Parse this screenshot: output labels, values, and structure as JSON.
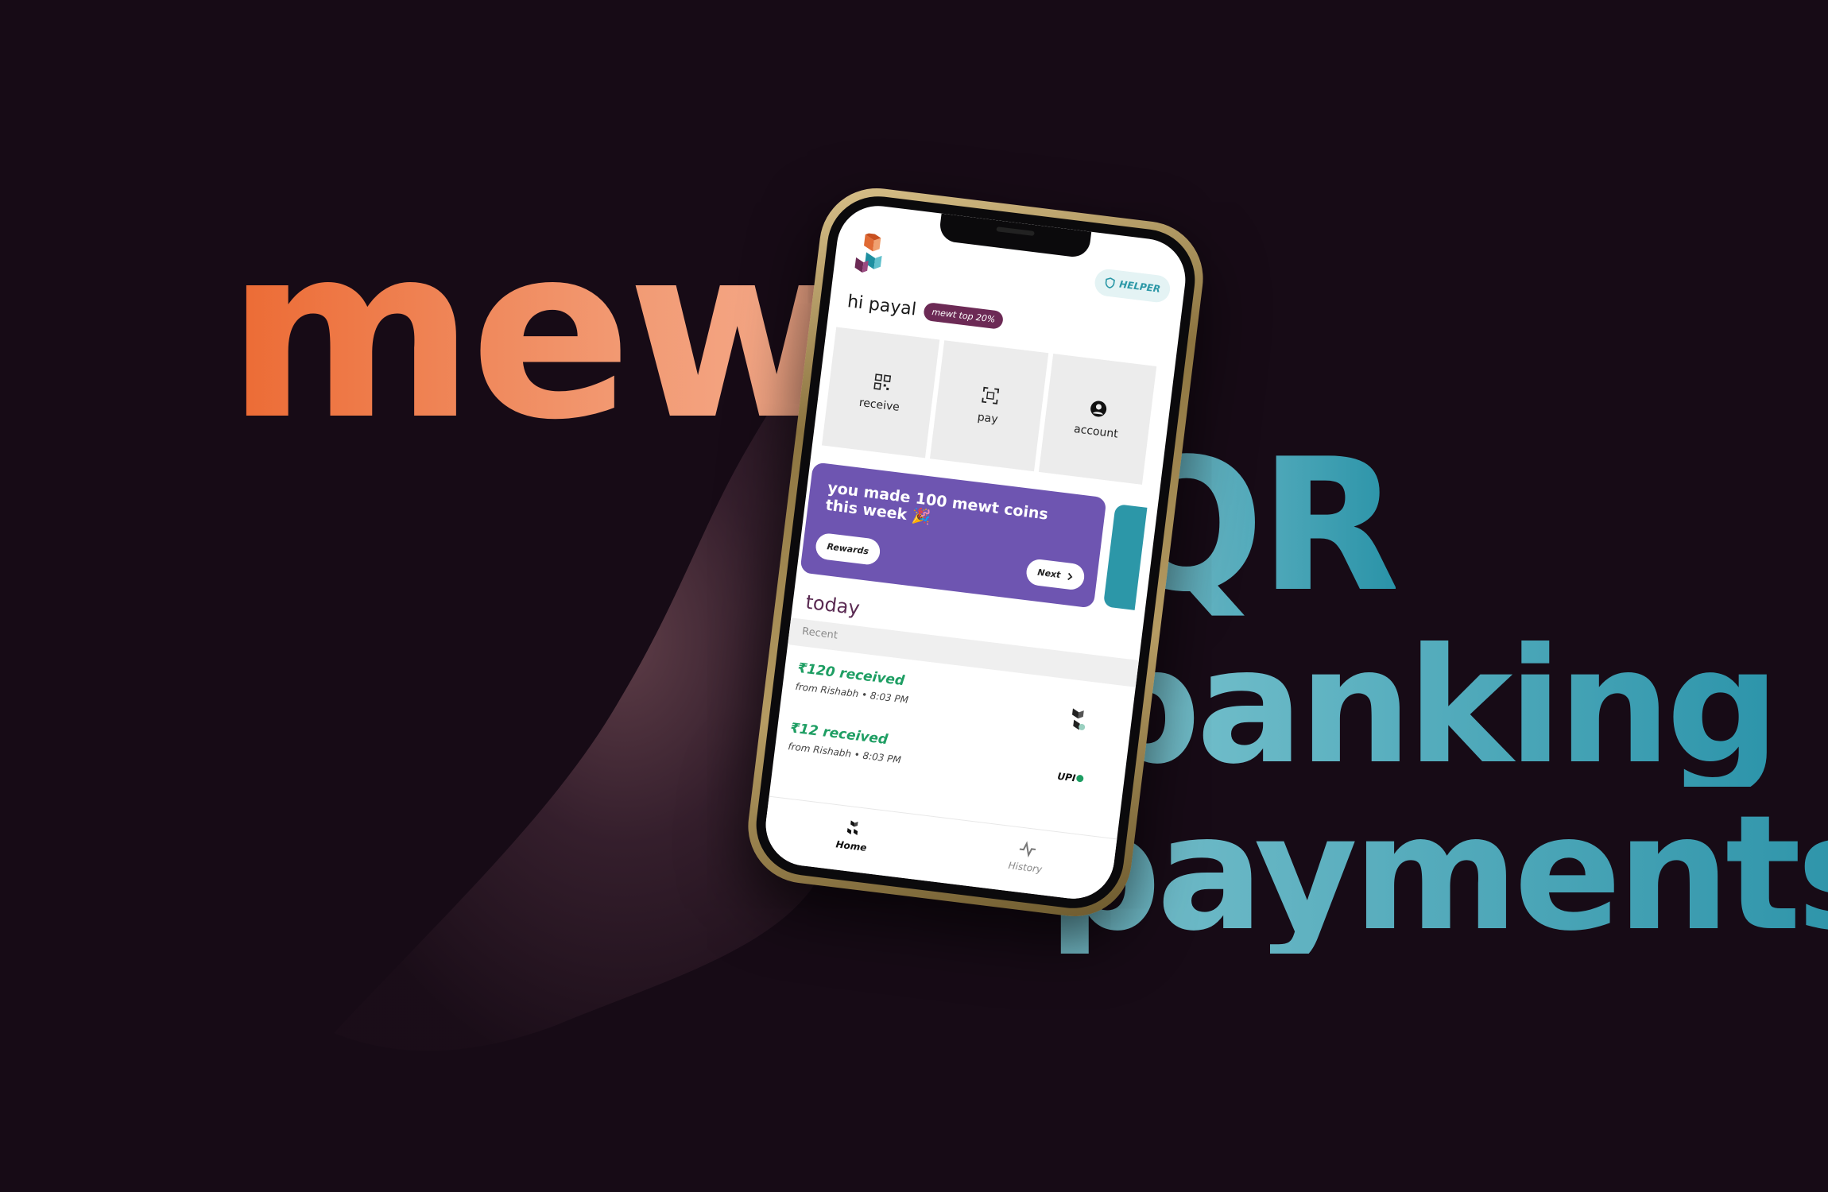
{
  "headline": {
    "brand": "mewt",
    "word_qr": "QR",
    "word_banking": "banking",
    "word_payments": "payments"
  },
  "app": {
    "helper_label": "HELPER",
    "greeting": "hi payal",
    "rank_badge": "mewt top 20%",
    "actions": [
      {
        "label": "receive",
        "icon": "qr-code-icon"
      },
      {
        "label": "pay",
        "icon": "scan-icon"
      },
      {
        "label": "account",
        "icon": "user-icon"
      }
    ],
    "promo": {
      "text": "you made 100 mewt coins this week 🎉",
      "rewards_label": "Rewards",
      "next_label": "Next"
    },
    "section_title": "today",
    "recent_label": "Recent",
    "transactions": [
      {
        "amount": "₹120 received",
        "meta": "from Rishabh • 8:03 PM",
        "icon": "mewt-logo-icon"
      },
      {
        "amount": "₹12 received",
        "meta": "from Rishabh • 8:03 PM",
        "icon": "upi-icon",
        "badge": "UPI"
      }
    ],
    "tabs": [
      {
        "label": "Home",
        "icon": "home-icon"
      },
      {
        "label": "History",
        "icon": "activity-icon"
      }
    ]
  },
  "colors": {
    "background": "#170b16",
    "brand_orange": "#ec6a33",
    "brand_teal": "#2a93a8",
    "promo_purple": "#6e55b1",
    "badge_plum": "#6c2a55",
    "received_green": "#1e9e63"
  }
}
